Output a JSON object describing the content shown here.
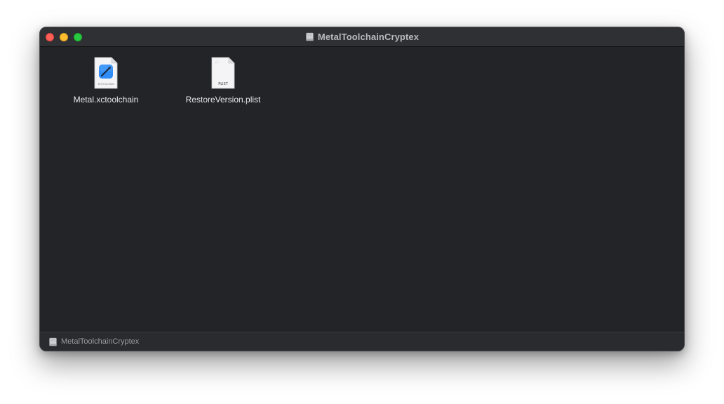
{
  "window": {
    "title": "MetalToolchainCryptex",
    "title_icon": "disk-image-icon"
  },
  "files": [
    {
      "name": "Metal.xctoolchain",
      "icon": "xctoolchain-file-icon",
      "badge": "XCTOOLCHAIN"
    },
    {
      "name": "RestoreVersion.plist",
      "icon": "plist-file-icon",
      "badge": "PLIST"
    }
  ],
  "statusbar": {
    "path_label": "MetalToolchainCryptex",
    "path_icon": "disk-image-icon"
  },
  "colors": {
    "close": "#fe5f57",
    "minimize": "#febc2e",
    "zoom": "#28c840",
    "window_bg": "#232428",
    "accent_blue": "#2f8df5"
  }
}
